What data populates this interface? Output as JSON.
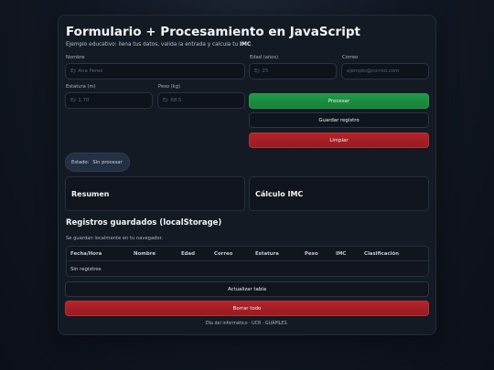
{
  "header": {
    "title": "Formulario + Procesamiento en JavaScript",
    "subtitle_prefix": "Ejemplo educativo: llena tus datos, valida la entrada y calcula tu ",
    "subtitle_bold": "IMC",
    "subtitle_suffix": "."
  },
  "form": {
    "nombre": {
      "label": "Nombre",
      "placeholder": "Ej: Ana Pérez",
      "value": ""
    },
    "edad": {
      "label": "Edad (años)",
      "placeholder": "Ej: 25",
      "value": ""
    },
    "correo": {
      "label": "Correo",
      "placeholder": "ejemplo@correo.com",
      "value": ""
    },
    "estatura": {
      "label": "Estatura (m)",
      "placeholder": "Ej: 1.70",
      "value": ""
    },
    "peso": {
      "label": "Peso (kg)",
      "placeholder": "Ej: 68.5",
      "value": ""
    }
  },
  "actions": {
    "procesar": "Procesar",
    "guardar": "Guardar registro",
    "limpiar": "Limpiar"
  },
  "status": {
    "label": "Estado:",
    "value": "Sin procesar"
  },
  "panels": {
    "resumen": "Resumen",
    "imc": "Cálculo IMC"
  },
  "registros": {
    "title": "Registros guardados (localStorage)",
    "note": "Se guardan localmente en tu navegador.",
    "columns": [
      "Fecha/Hora",
      "Nombre",
      "Edad",
      "Correo",
      "Estatura",
      "Peso",
      "IMC",
      "Clasificación"
    ],
    "empty": "Sin registros",
    "actualizar": "Actualizar tabla",
    "borrar": "Borrar todo"
  },
  "footer": "Día del informático · UCR · GUÁPILES.",
  "colors": {
    "primary": "#1f9a48",
    "danger": "#b3242a",
    "background": "#0b0f17",
    "card": "#141a24"
  }
}
